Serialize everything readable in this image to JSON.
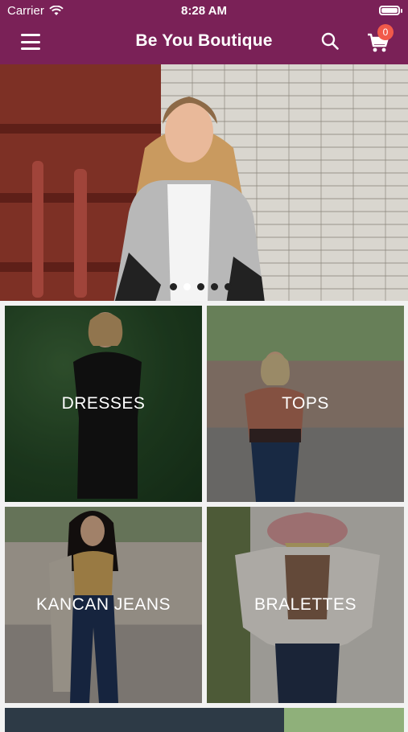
{
  "status": {
    "carrier": "Carrier",
    "time": "8:28 AM"
  },
  "header": {
    "title": "Be You Boutique",
    "cart_count": "0"
  },
  "colors": {
    "brand": "#7a2157",
    "badge": "#f15a4a"
  },
  "carousel": {
    "slide_count": 5,
    "active_index": 1
  },
  "categories": [
    {
      "label": "DRESSES"
    },
    {
      "label": "TOPS"
    },
    {
      "label": "KANCAN JEANS"
    },
    {
      "label": "BRALETTES"
    }
  ]
}
